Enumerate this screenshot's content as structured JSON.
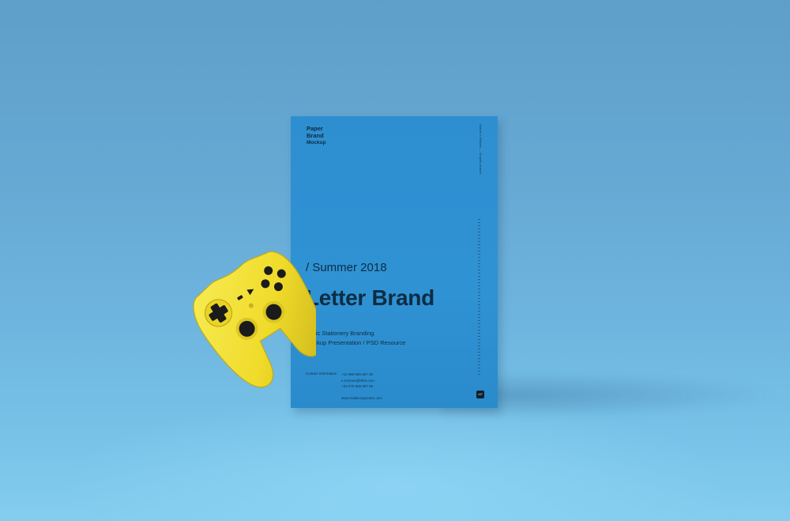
{
  "colors": {
    "background": "#66a9d4",
    "paper": "#2f92d3",
    "ink": "#0f2c43",
    "controller": "#f2e12f",
    "buttons": "#1a1a1a"
  },
  "letter": {
    "logo": [
      "Paper",
      "Brand",
      "Mockup"
    ],
    "season": "/ Summer 2018",
    "title": "Letter Brand",
    "subtitle_lines": [
      "Basic Stationery Branding",
      "Mockup Presentation / PSD Resource"
    ],
    "contact_label": "Contact Information",
    "contact_lines": [
      "+11 999 966 987 39",
      "e.mmmm@bfrts.com",
      "+33 078 965 987 65"
    ],
    "website": "www.mailaccquenam.com",
    "side_text": "Nature x Willows — Graphic branch",
    "badge": "v07"
  },
  "controller": {
    "icon": "gamepad-icon",
    "color": "yellow"
  }
}
